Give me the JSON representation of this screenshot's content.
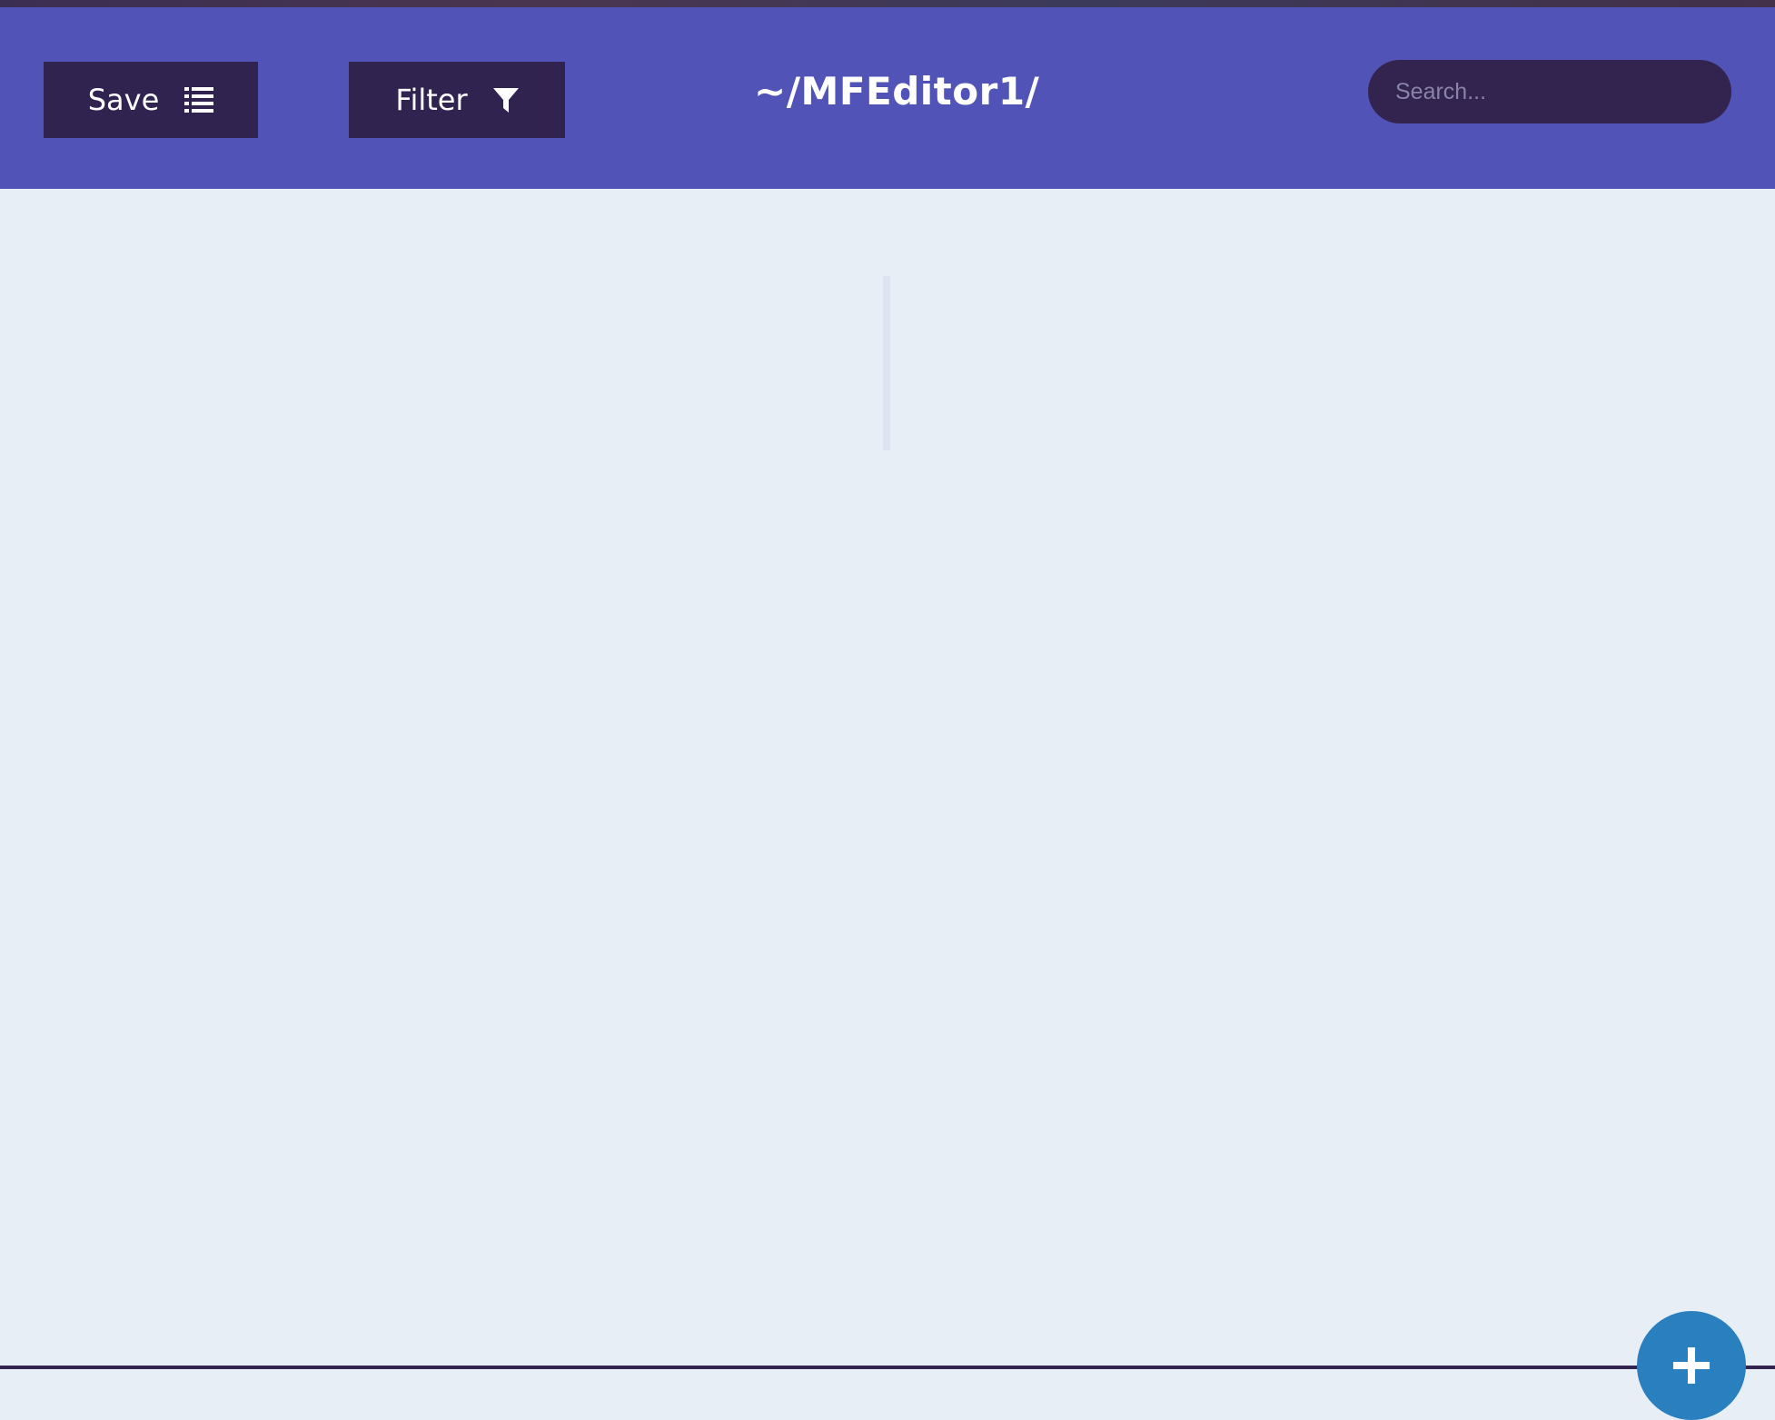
{
  "toolbar": {
    "save_label": "Save",
    "save_icon": "list-icon",
    "filter_label": "Filter",
    "filter_icon": "funnel-icon",
    "title": "~/MFEditor1/"
  },
  "search": {
    "placeholder": "Search...",
    "value": ""
  },
  "fab": {
    "icon": "plus-icon"
  },
  "colors": {
    "header": "#5153b7",
    "button": "#302350",
    "search_bg": "#33244f",
    "content_bg": "#e8eef6",
    "fab": "#2a7fbf"
  }
}
